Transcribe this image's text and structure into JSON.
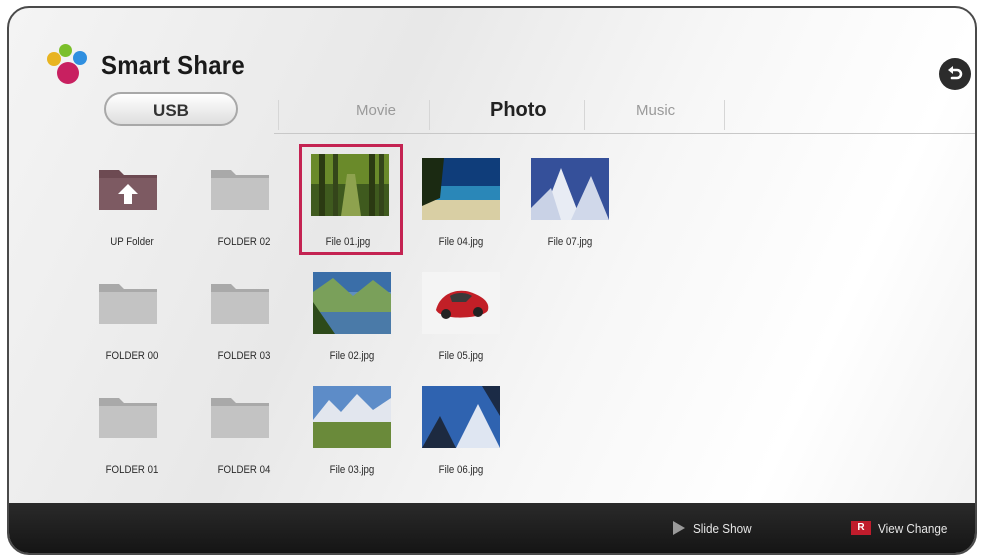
{
  "app": {
    "title": "Smart Share"
  },
  "source": {
    "label": "USB"
  },
  "tabs": [
    {
      "label": "Movie",
      "active": false
    },
    {
      "label": "Photo",
      "active": true
    },
    {
      "label": "Music",
      "active": false
    }
  ],
  "items": [
    {
      "label": "UP Folder",
      "kind": "up-folder"
    },
    {
      "label": "FOLDER 02",
      "kind": "folder"
    },
    {
      "label": "File 01.jpg",
      "kind": "photo",
      "selected": true
    },
    {
      "label": "File 04.jpg",
      "kind": "photo"
    },
    {
      "label": "File 07.jpg",
      "kind": "photo"
    },
    {
      "label": "FOLDER 00",
      "kind": "folder"
    },
    {
      "label": "FOLDER 03",
      "kind": "folder"
    },
    {
      "label": "File 02.jpg",
      "kind": "photo"
    },
    {
      "label": "File 05.jpg",
      "kind": "photo"
    },
    {
      "label": "FOLDER 01",
      "kind": "folder"
    },
    {
      "label": "FOLDER 04",
      "kind": "folder"
    },
    {
      "label": "File 03.jpg",
      "kind": "photo"
    },
    {
      "label": "File 06.jpg",
      "kind": "photo"
    }
  ],
  "bottom_bar": {
    "slide_show_label": "Slide Show",
    "view_change_key": "R",
    "view_change_label": "View Change"
  },
  "colors": {
    "selection": "#c42352",
    "red_key": "#c01c2c",
    "bar": "#1c1c1c"
  },
  "icons": {
    "back": "back-arrow-icon",
    "play": "play-icon",
    "folder": "folder-icon",
    "up_folder": "up-folder-icon"
  }
}
